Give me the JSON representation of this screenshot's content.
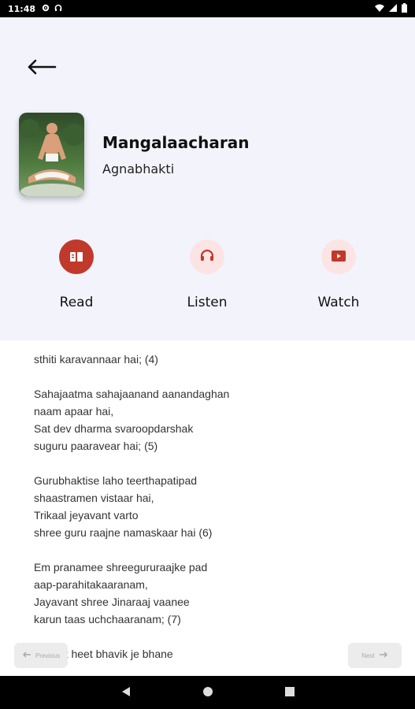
{
  "status_bar": {
    "time": "11:48",
    "left_icons": [
      "gear-icon",
      "headset-icon"
    ],
    "right_icons": [
      "wifi-icon",
      "signal-icon",
      "battery-icon"
    ]
  },
  "header": {
    "back_icon": "arrow-left-icon",
    "title": "Mangalaacharan",
    "subtitle": "Agnabhakti"
  },
  "actions": [
    {
      "label": "Read",
      "icon": "book-icon",
      "active": true
    },
    {
      "label": "Listen",
      "icon": "headphones-icon",
      "active": false
    },
    {
      "label": "Watch",
      "icon": "video-icon",
      "active": false
    }
  ],
  "content": {
    "lines": [
      [
        "sthiti karavannaar hai; (4)"
      ],
      [
        "Sahajaatma sahajaanand aanandaghan",
        "naam apaar hai,",
        "Sat dev dharma svaroopdarshak",
        "suguru paaravear hai; (5)"
      ],
      [
        "Gurubhaktise laho teerthapatipad",
        "shaastramen vistaar hai,",
        "Trikaal jeyavant varto",
        "shree guru raajne namaskaar hai (6)"
      ],
      [
        "Em pranamee shreegururaajke pad",
        "aap-parahitakaaranam,",
        "Jayavant shree Jinaraaj vaanee",
        "karun taas uchchaaranam; (7)"
      ],
      [
        "Ekaant heet bhavik je bhane"
      ]
    ]
  },
  "pager": {
    "previous_label": "Previous",
    "next_label": "Next"
  },
  "colors": {
    "header_bg": "#f3f3fc",
    "accent": "#c0392b",
    "accent_light": "#fde4e4"
  }
}
